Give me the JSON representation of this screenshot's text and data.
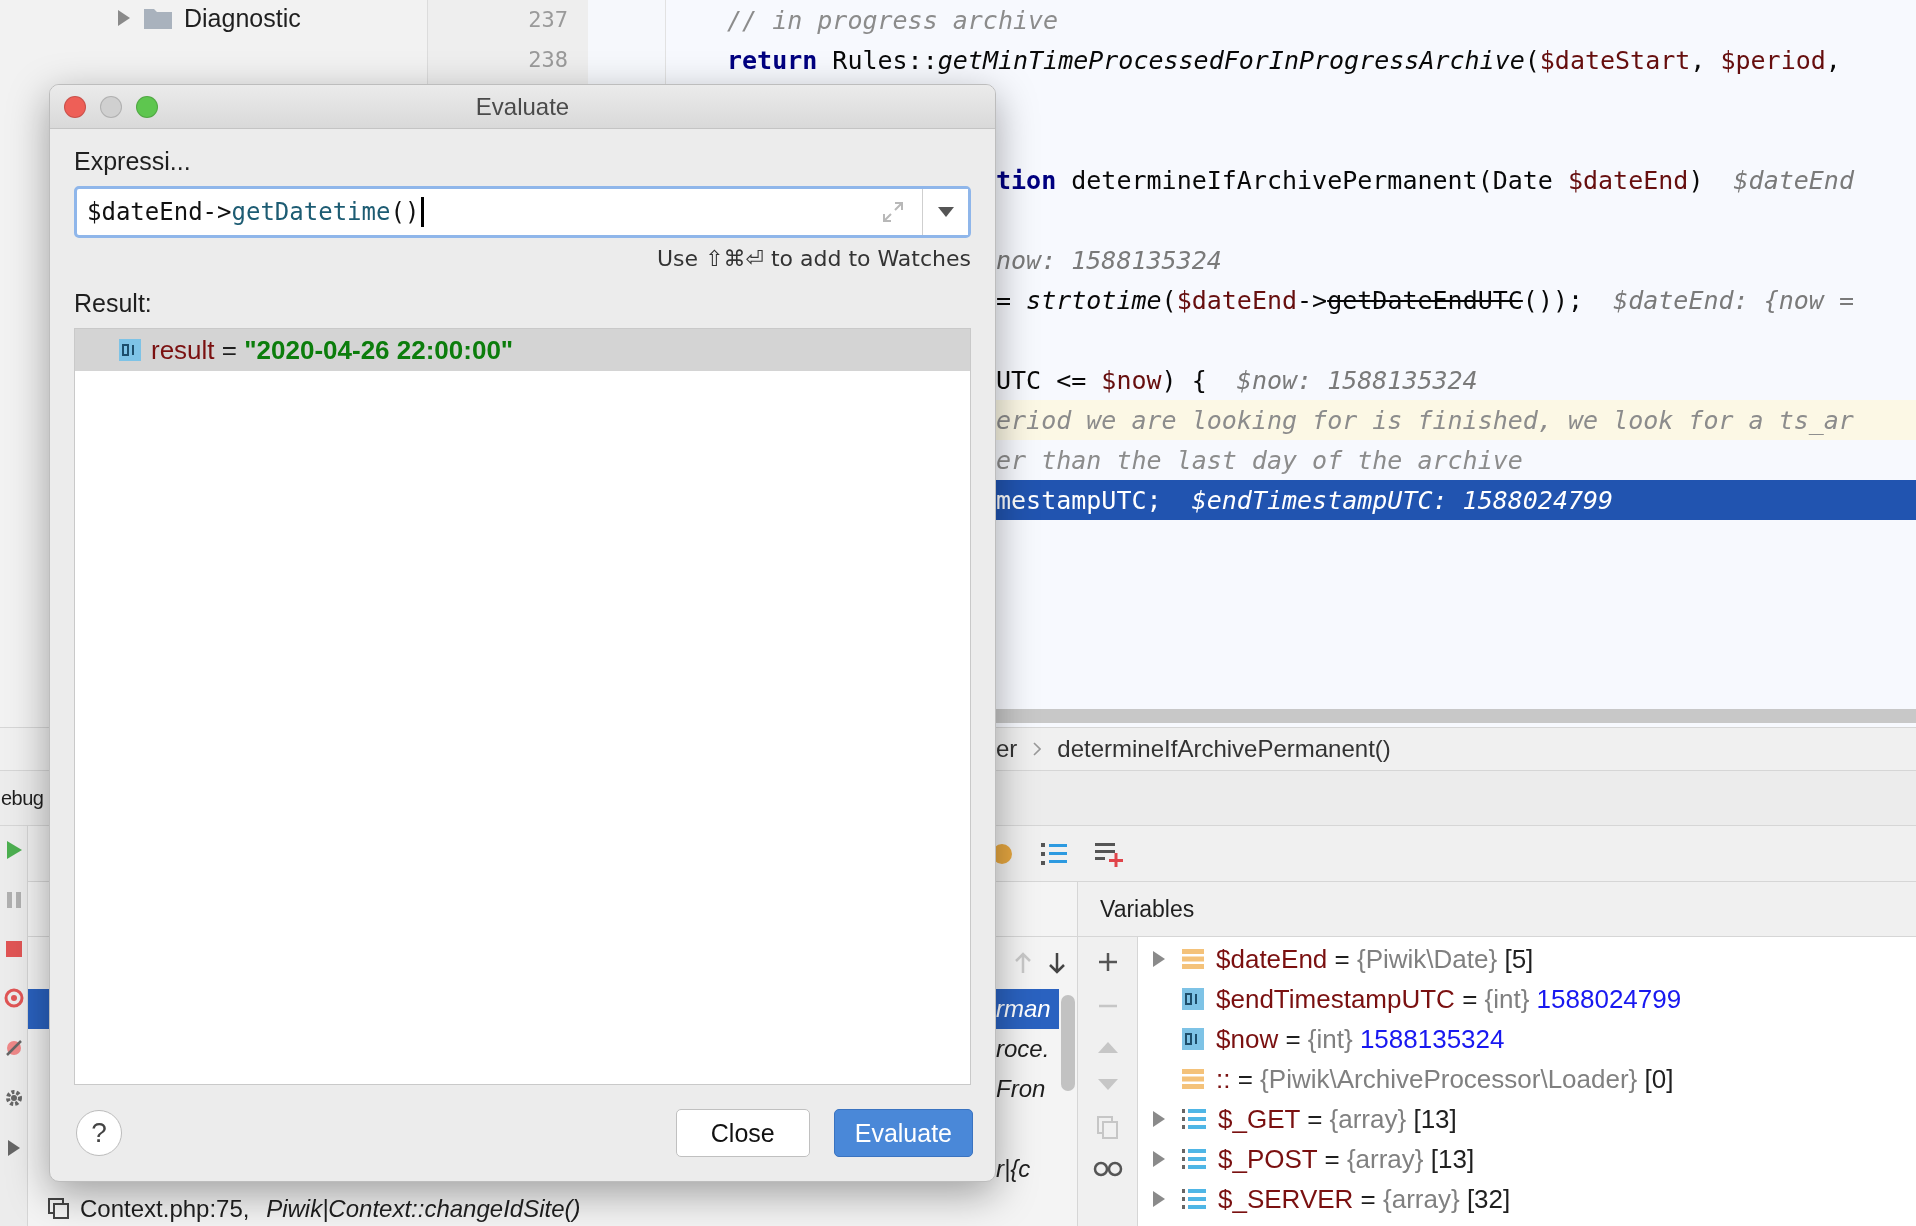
{
  "project_tree": {
    "items": [
      {
        "label": "Diagnostic",
        "expanded": false
      }
    ]
  },
  "gutter": {
    "line_numbers": [
      "237",
      "238"
    ]
  },
  "editor": {
    "lines": [
      {
        "execution_point": false,
        "caret_line": false,
        "segments": [
          {
            "text": "// in progress archive",
            "kind": "comment"
          }
        ]
      },
      {
        "execution_point": false,
        "caret_line": false,
        "segments": [
          {
            "text": "return",
            "kind": "keyword"
          },
          {
            "text": " Rules::",
            "kind": "plain"
          },
          {
            "text": "getMinTimeProcessedForInProgressArchive",
            "kind": "call"
          },
          {
            "text": "(",
            "kind": "plain"
          },
          {
            "text": "$dateStart",
            "kind": "variable"
          },
          {
            "text": ", ",
            "kind": "plain"
          },
          {
            "text": "$period",
            "kind": "variable"
          },
          {
            "text": ",",
            "kind": "plain"
          }
        ]
      },
      {
        "execution_point": false,
        "caret_line": false,
        "segments": [
          {
            "text": "tion",
            "kind": "keyword"
          },
          {
            "text": " determineIfArchivePermanent(Date ",
            "kind": "plain"
          },
          {
            "text": "$dateEnd",
            "kind": "variable"
          },
          {
            "text": ")",
            "kind": "plain"
          },
          {
            "text": "  $dateEnd",
            "kind": "hint"
          }
        ]
      },
      {
        "execution_point": false,
        "caret_line": false,
        "segments": [
          {
            "text": "now: 1588135324",
            "kind": "hint"
          }
        ]
      },
      {
        "execution_point": false,
        "caret_line": false,
        "segments": [
          {
            "text": "= ",
            "kind": "plain"
          },
          {
            "text": "strtotime",
            "kind": "call"
          },
          {
            "text": "(",
            "kind": "plain"
          },
          {
            "text": "$dateEnd",
            "kind": "variable"
          },
          {
            "text": "->",
            "kind": "plain"
          },
          {
            "text": "getDateEndUTC",
            "kind": "deprecated"
          },
          {
            "text": "());",
            "kind": "plain"
          },
          {
            "text": "  $dateEnd: {now =",
            "kind": "hint"
          }
        ]
      },
      {
        "execution_point": false,
        "caret_line": false,
        "segments": [
          {
            "text": "UTC <= ",
            "kind": "plain"
          },
          {
            "text": "$now",
            "kind": "variable"
          },
          {
            "text": ") {",
            "kind": "plain"
          },
          {
            "text": "  $now: 1588135324",
            "kind": "hint"
          }
        ]
      },
      {
        "execution_point": false,
        "caret_line": true,
        "segments": [
          {
            "text": "eriod we are looking for is finished, we look for a ts_ar",
            "kind": "comment"
          }
        ]
      },
      {
        "execution_point": false,
        "caret_line": false,
        "segments": [
          {
            "text": "er than the last day of the archive",
            "kind": "comment"
          }
        ]
      },
      {
        "execution_point": true,
        "caret_line": false,
        "segments": [
          {
            "text": "mestampUTC;",
            "kind": "plain"
          },
          {
            "text": "  $endTimestampUTC: 1588024799",
            "kind": "hint"
          }
        ]
      }
    ]
  },
  "breadcrumb": [
    "er",
    "determineIfArchivePermanent()"
  ],
  "debug": {
    "title": "ebug",
    "frames": [
      {
        "function": "rman",
        "selected": true
      },
      {
        "function": "roce.",
        "selected": false
      },
      {
        "function": "Fron",
        "selected": false
      },
      {
        "function": "r|{c",
        "selected": false
      },
      {
        "location": "Context.php:75, ",
        "function": "Piwik|Context::changeIdSite()",
        "selected": false
      }
    ],
    "variables": {
      "title": "Variables",
      "items": [
        {
          "name": "$dateEnd",
          "operator": "=",
          "type": "{Piwik\\Date}",
          "value": "[5]",
          "kind": "object",
          "expandable": true
        },
        {
          "name": "$endTimestampUTC",
          "operator": "=",
          "type": "{int}",
          "value": "1588024799",
          "kind": "int",
          "expandable": false
        },
        {
          "name": "$now",
          "operator": "=",
          "type": "{int}",
          "value": "1588135324",
          "kind": "int",
          "expandable": false
        },
        {
          "name": "::",
          "operator": "=",
          "type": "{Piwik\\ArchiveProcessor\\Loader}",
          "value": "[0]",
          "kind": "object",
          "expandable": false
        },
        {
          "name": "$_GET",
          "operator": "=",
          "type": "{array}",
          "value": "[13]",
          "kind": "array",
          "expandable": true
        },
        {
          "name": "$_POST",
          "operator": "=",
          "type": "{array}",
          "value": "[13]",
          "kind": "array",
          "expandable": true
        },
        {
          "name": "$_SERVER",
          "operator": "=",
          "type": "{array}",
          "value": "[32]",
          "kind": "array",
          "expandable": true
        }
      ]
    }
  },
  "dialog": {
    "title": "Evaluate",
    "expression_label": "Expressi...",
    "expression": {
      "segments": [
        {
          "text": "$dateEnd->",
          "kind": "plain"
        },
        {
          "text": "getDatetime",
          "kind": "method"
        },
        {
          "text": "()",
          "kind": "plain"
        }
      ]
    },
    "watch_hint": "Use ⇧⌘⏎ to add to Watches",
    "result_label": "Result:",
    "result": {
      "name": "result",
      "operator": "=",
      "value": "\"2020-04-26 22:00:00\"",
      "selected": true
    },
    "help_label": "?",
    "buttons": [
      {
        "label": "Close",
        "primary": false
      },
      {
        "label": "Evaluate",
        "primary": true
      }
    ]
  }
}
